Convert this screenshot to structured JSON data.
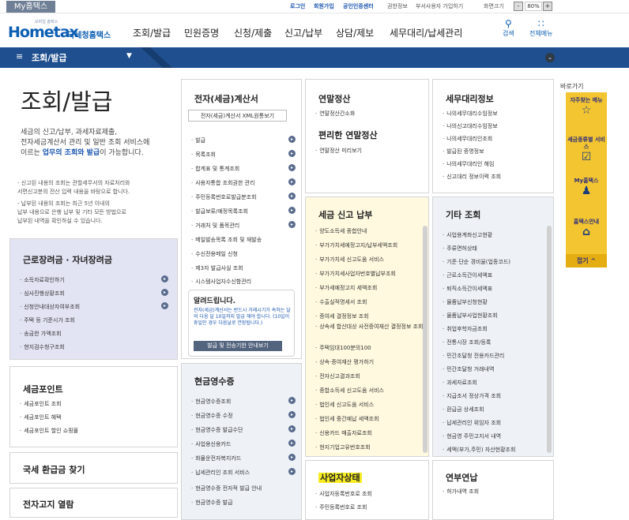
{
  "util": {
    "my": "My홈택스",
    "login": "로그인",
    "join": "회원가입",
    "cert": "공인인증센터",
    "auth": "권한정보",
    "mgr": "부서사용자 가입하기",
    "zoomLabel": "화면크기",
    "zoom": "80%",
    "minus": "-",
    "plus": "+"
  },
  "logo": {
    "small": "모바일 홈택스",
    "big": "Hometax",
    "sub": "국세청홈택스"
  },
  "nav": [
    "조회/발급",
    "민원증명",
    "신청/제출",
    "신고/납부",
    "상담/제보",
    "세무대리/납세관리"
  ],
  "search": {
    "icon": "search-icon",
    "label": "검색"
  },
  "allmenu": {
    "icon": "grid-icon",
    "label": "전체메뉴"
  },
  "bar": {
    "menu": "≡",
    "current": "조회/발급",
    "dropdown": "▼",
    "toggle": "⌄"
  },
  "page": {
    "title": "조회/발급",
    "desc1": "세금의 신고/납부, 과세자료제출,",
    "desc2": "전자세금계산서 관리 및 일반 조회 서비스에",
    "desc3a": "이르는 ",
    "desc3b": "업무의 조회와 발급",
    "desc3c": "이 가능합니다.",
    "note1": "- 신고된 내용의 조회는 관할세무서의 자료처리와",
    "note2": "  서면신고분의 전산 입력 내용을 바탕으로 합니다.",
    "note3": "- 납부된 내용의 조회는 최근 5년 이내의",
    "note4": "  납부 내용으로 은행 납부 및 기타 모든 방법으로",
    "note5": "  납부된 내역을 확인하실 수 있습니다."
  },
  "geunro": {
    "title": "근로장려금 · 자녀장려금",
    "items": [
      "소득자료확인하기",
      "심사진행상황조회",
      "신청안내대상자여부조회",
      "주택 등 기준시가 조회",
      "송금한 가액조회",
      "현지검수청구조회"
    ]
  },
  "point": {
    "title": "세금포인트",
    "items": [
      "세금포인트 조회",
      "세금포인트 혜택",
      "세금포인트 할인 쇼핑몰"
    ]
  },
  "refund": {
    "title": "국세 환급금 찾기"
  },
  "notice": {
    "title": "전자고지 열람"
  },
  "einvoice": {
    "title": "전자(세금)계산서",
    "xml": "전자(세금)계산서 XML원통보기",
    "items": [
      "발급",
      "목록조회",
      "합계표 및 통계조회",
      "사용자통합 조회권한 관리",
      "주민등록번호로발급분조회",
      "발급보류/예정목록조회",
      "거래처 및 품목관리",
      "메일발송목록 조회 및 재발송",
      "수신전용메일 신청",
      "제3자 발급사실 조회",
      "시스템사업자수신함관리"
    ]
  },
  "alert": {
    "title": "알려드립니다.",
    "text": "전자(세금)계산서는 반드시 거래시기가 속하는 달의 다음 달 10일까지 발급 해야 합니다. (10일이 휴일인 경우 다음날로 연장됩니다.)",
    "btn": "발급 및 전송기한 안내보기"
  },
  "cash": {
    "title": "현금영수증",
    "items": [
      "현금영수증조회",
      "현금영수증 수정",
      "현금영수증 발급수단",
      "사업용신용카드",
      "화물운전자복지카드",
      "납세관리인 조회 서비스",
      "현금영수증 전자적 발급 안내",
      "현금영수증 발급"
    ]
  },
  "yeonmal": {
    "title": "연말정산",
    "items": [
      "연말정산간소화"
    ]
  },
  "easy": {
    "title": "편리한 연말정산",
    "items": [
      "연말정산 미리보기"
    ]
  },
  "tax": {
    "title": "세금 신고 납부",
    "items": [
      "양도소득세 종합안내",
      "부가가치세예정고지/납부세액조회",
      "부가가치세 신고도움 서비스",
      "부가가치세사업자번호별납부조회",
      "부가세예정고지 세액조회",
      "수출실적명세서 조회",
      "증여세 결정정보 조회",
      "상속세 합산대상 사전증여재산 결정정보 조회",
      "주택임대100분의100",
      "상속·증여재산 평가하기",
      "전자신고결과조회",
      "종합소득세 신고도움 서비스",
      "법인세 신고도움 서비스",
      "법인세 중간예납 세액조회",
      "신용카드 매출자료조회",
      "현지기업고유번호조회"
    ]
  },
  "saup": {
    "title": "사업자상태",
    "items": [
      "사업자등록번호로 조회",
      "주민등록번호로 조회"
    ]
  },
  "semu": {
    "title": "세무대리정보",
    "items": [
      "나의세무대리수임정보",
      "나의신고대리수임정보",
      "나의세무대리인조회",
      "발급된 증명정보",
      "나의세무대리인 해임",
      "신고대리 정보이력 조회"
    ]
  },
  "etc": {
    "title": "기타 조회",
    "items": [
      "사업용계좌신고현황",
      "주류면허상태",
      "기준·단순 경비율(업종코드)",
      "근로소득간이세액표",
      "퇴직소득간이세액표",
      "물품납부신청현황",
      "물품납부사업현황조회",
      "취업후학자금조회",
      "전통시장 조회/등록",
      "민간조달청 전용카드관리",
      "민간조달청 거래내역",
      "과세자료조회",
      "지급조서 정상가격 조회",
      "환급금 상세조회",
      "납세관리인 위임자 조회",
      "현금영 주민고지서 내역",
      "세액(부가,주민) 자산현황조회"
    ]
  },
  "pension": {
    "title": "연부연납",
    "items": [
      "허가내역 조회"
    ]
  },
  "quick": {
    "title": "바로가기",
    "items": [
      {
        "icon": "star-icon",
        "label": "자주찾는 메뉴"
      },
      {
        "icon": "checkbox-icon",
        "label": "세금종류별 서비스"
      },
      {
        "icon": "person-icon",
        "label": "My홈택스"
      },
      {
        "icon": "home-icon",
        "label": "홈택스안내"
      }
    ],
    "close": "접기"
  }
}
